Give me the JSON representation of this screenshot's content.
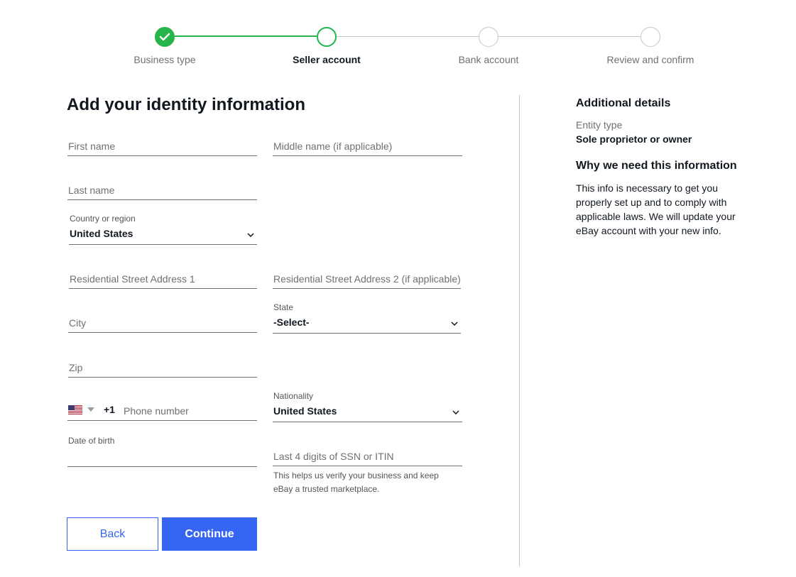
{
  "stepper": {
    "steps": [
      {
        "label": "Business type",
        "state": "done"
      },
      {
        "label": "Seller account",
        "state": "current"
      },
      {
        "label": "Bank account",
        "state": "upcoming"
      },
      {
        "label": "Review and confirm",
        "state": "upcoming"
      }
    ]
  },
  "form": {
    "title": "Add your identity information",
    "first_name": {
      "placeholder": "First name",
      "value": ""
    },
    "middle_name": {
      "placeholder": "Middle name (if applicable)",
      "value": ""
    },
    "last_name": {
      "placeholder": "Last name",
      "value": ""
    },
    "country": {
      "label": "Country or region",
      "value": "United States"
    },
    "address1": {
      "placeholder": "Residential Street Address 1",
      "value": ""
    },
    "address2": {
      "placeholder": "Residential Street Address 2 (if applicable)",
      "value": ""
    },
    "city": {
      "placeholder": "City",
      "value": ""
    },
    "state": {
      "label": "State",
      "value": "-Select-"
    },
    "zip": {
      "placeholder": "Zip",
      "value": ""
    },
    "phone": {
      "country_code": "+1",
      "placeholder": "Phone number",
      "flag": "us-flag-icon",
      "value": ""
    },
    "nationality": {
      "label": "Nationality",
      "value": "United States"
    },
    "dob": {
      "label": "Date of birth",
      "value": ""
    },
    "ssn": {
      "placeholder": "Last 4 digits of SSN or ITIN",
      "value": "",
      "help": "This helps us verify your business and keep eBay a trusted marketplace."
    }
  },
  "buttons": {
    "back": "Back",
    "continue": "Continue"
  },
  "sidebar": {
    "details_heading": "Additional details",
    "entity_label": "Entity type",
    "entity_value": "Sole proprietor or owner",
    "why_heading": "Why we need this information",
    "why_text": "This info is necessary to get you properly set up and to comply with applicable laws. We will update your eBay account with your new info."
  },
  "colors": {
    "accent": "#3665f3",
    "success": "#25b54a",
    "text": "#111820",
    "muted": "#707070"
  }
}
